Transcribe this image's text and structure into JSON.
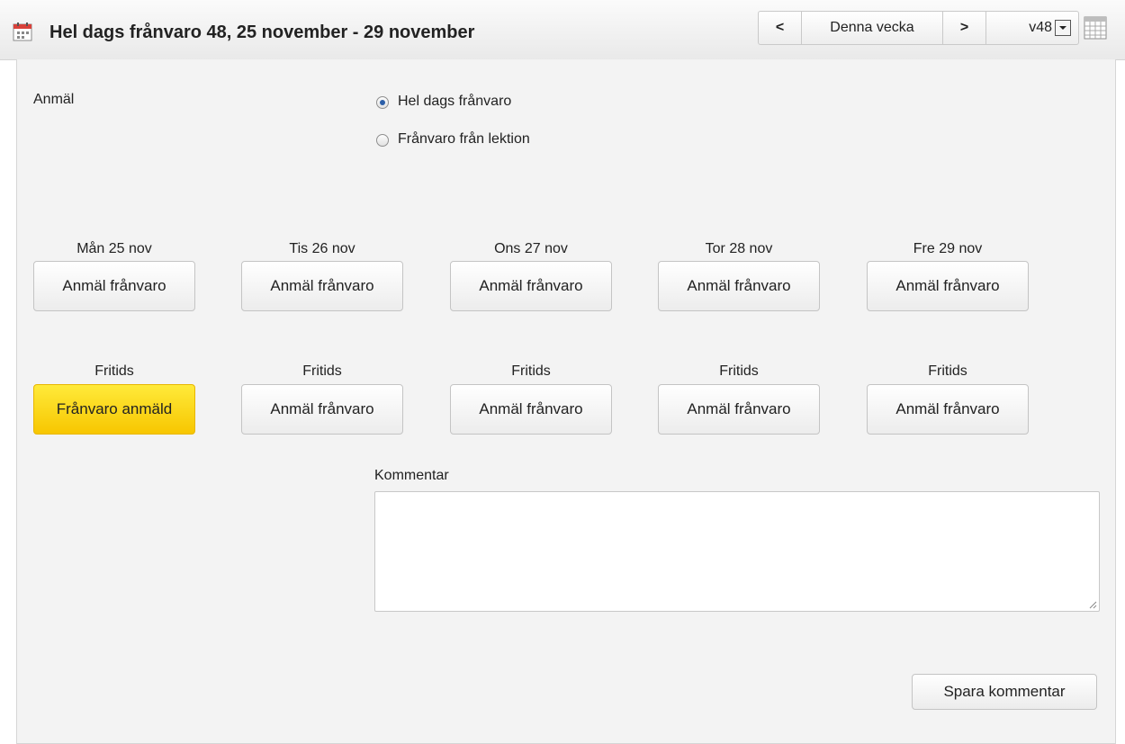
{
  "header": {
    "title": "Hel dags frånvaro 48, 25 november - 29 november",
    "calendar_icon": "calendar-icon",
    "nav": {
      "prev": "<",
      "today": "Denna vecka",
      "next": ">",
      "week_value": "v48",
      "week_options_icon": "chevron-down-icon",
      "grid_icon": "calendar-grid-icon"
    }
  },
  "form": {
    "report_label": "Anmäl",
    "absence_types": [
      {
        "label": "Hel dags frånvaro",
        "selected": true
      },
      {
        "label": "Frånvaro från lektion",
        "selected": false
      }
    ],
    "days": [
      {
        "label": "Mån 25 nov",
        "button": "Anmäl frånvaro",
        "fritids_label": "Fritids",
        "fritids_button": "Frånvaro anmäld",
        "fritids_reported": true
      },
      {
        "label": "Tis 26 nov",
        "button": "Anmäl frånvaro",
        "fritids_label": "Fritids",
        "fritids_button": "Anmäl frånvaro",
        "fritids_reported": false
      },
      {
        "label": "Ons 27 nov",
        "button": "Anmäl frånvaro",
        "fritids_label": "Fritids",
        "fritids_button": "Anmäl frånvaro",
        "fritids_reported": false
      },
      {
        "label": "Tor 28 nov",
        "button": "Anmäl frånvaro",
        "fritids_label": "Fritids",
        "fritids_button": "Anmäl frånvaro",
        "fritids_reported": false
      },
      {
        "label": "Fre 29 nov",
        "button": "Anmäl frånvaro",
        "fritids_label": "Fritids",
        "fritids_button": "Anmäl frånvaro",
        "fritids_reported": false
      }
    ],
    "comment_label": "Kommentar",
    "comment_value": "",
    "save_label": "Spara kommentar"
  },
  "colors": {
    "reported_yellow": "#ffd800",
    "radio_selected": "#2c5fa8",
    "panel_bg": "#f3f3f3"
  }
}
